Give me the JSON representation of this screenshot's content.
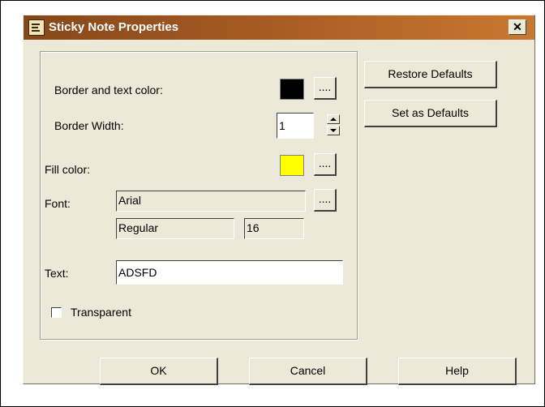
{
  "window": {
    "title": "Sticky Note Properties",
    "close_glyph": "✕",
    "icon": "sticky-note-app-icon"
  },
  "form": {
    "border_color_label": "Border and text color:",
    "border_color": "#000000",
    "ellipsis_label": "....",
    "border_width_label": "Border Width:",
    "border_width_value": "1",
    "fill_color_label": "Fill color:",
    "fill_color": "#ffff00",
    "font_label": "Font:",
    "font_name": "Arial",
    "font_style": "Regular",
    "font_size": "16",
    "text_label": "Text:",
    "text_value": "ADSFD",
    "transparent_label": "Transparent",
    "transparent_checked": false
  },
  "side_buttons": {
    "restore_defaults": "Restore Defaults",
    "set_as_defaults": "Set as Defaults"
  },
  "footer": {
    "ok": "OK",
    "cancel": "Cancel",
    "help": "Help"
  },
  "colors": {
    "title_gradient_start": "#86471a",
    "title_gradient_end": "#c8782f",
    "dialog_bg": "#ece9d8"
  }
}
